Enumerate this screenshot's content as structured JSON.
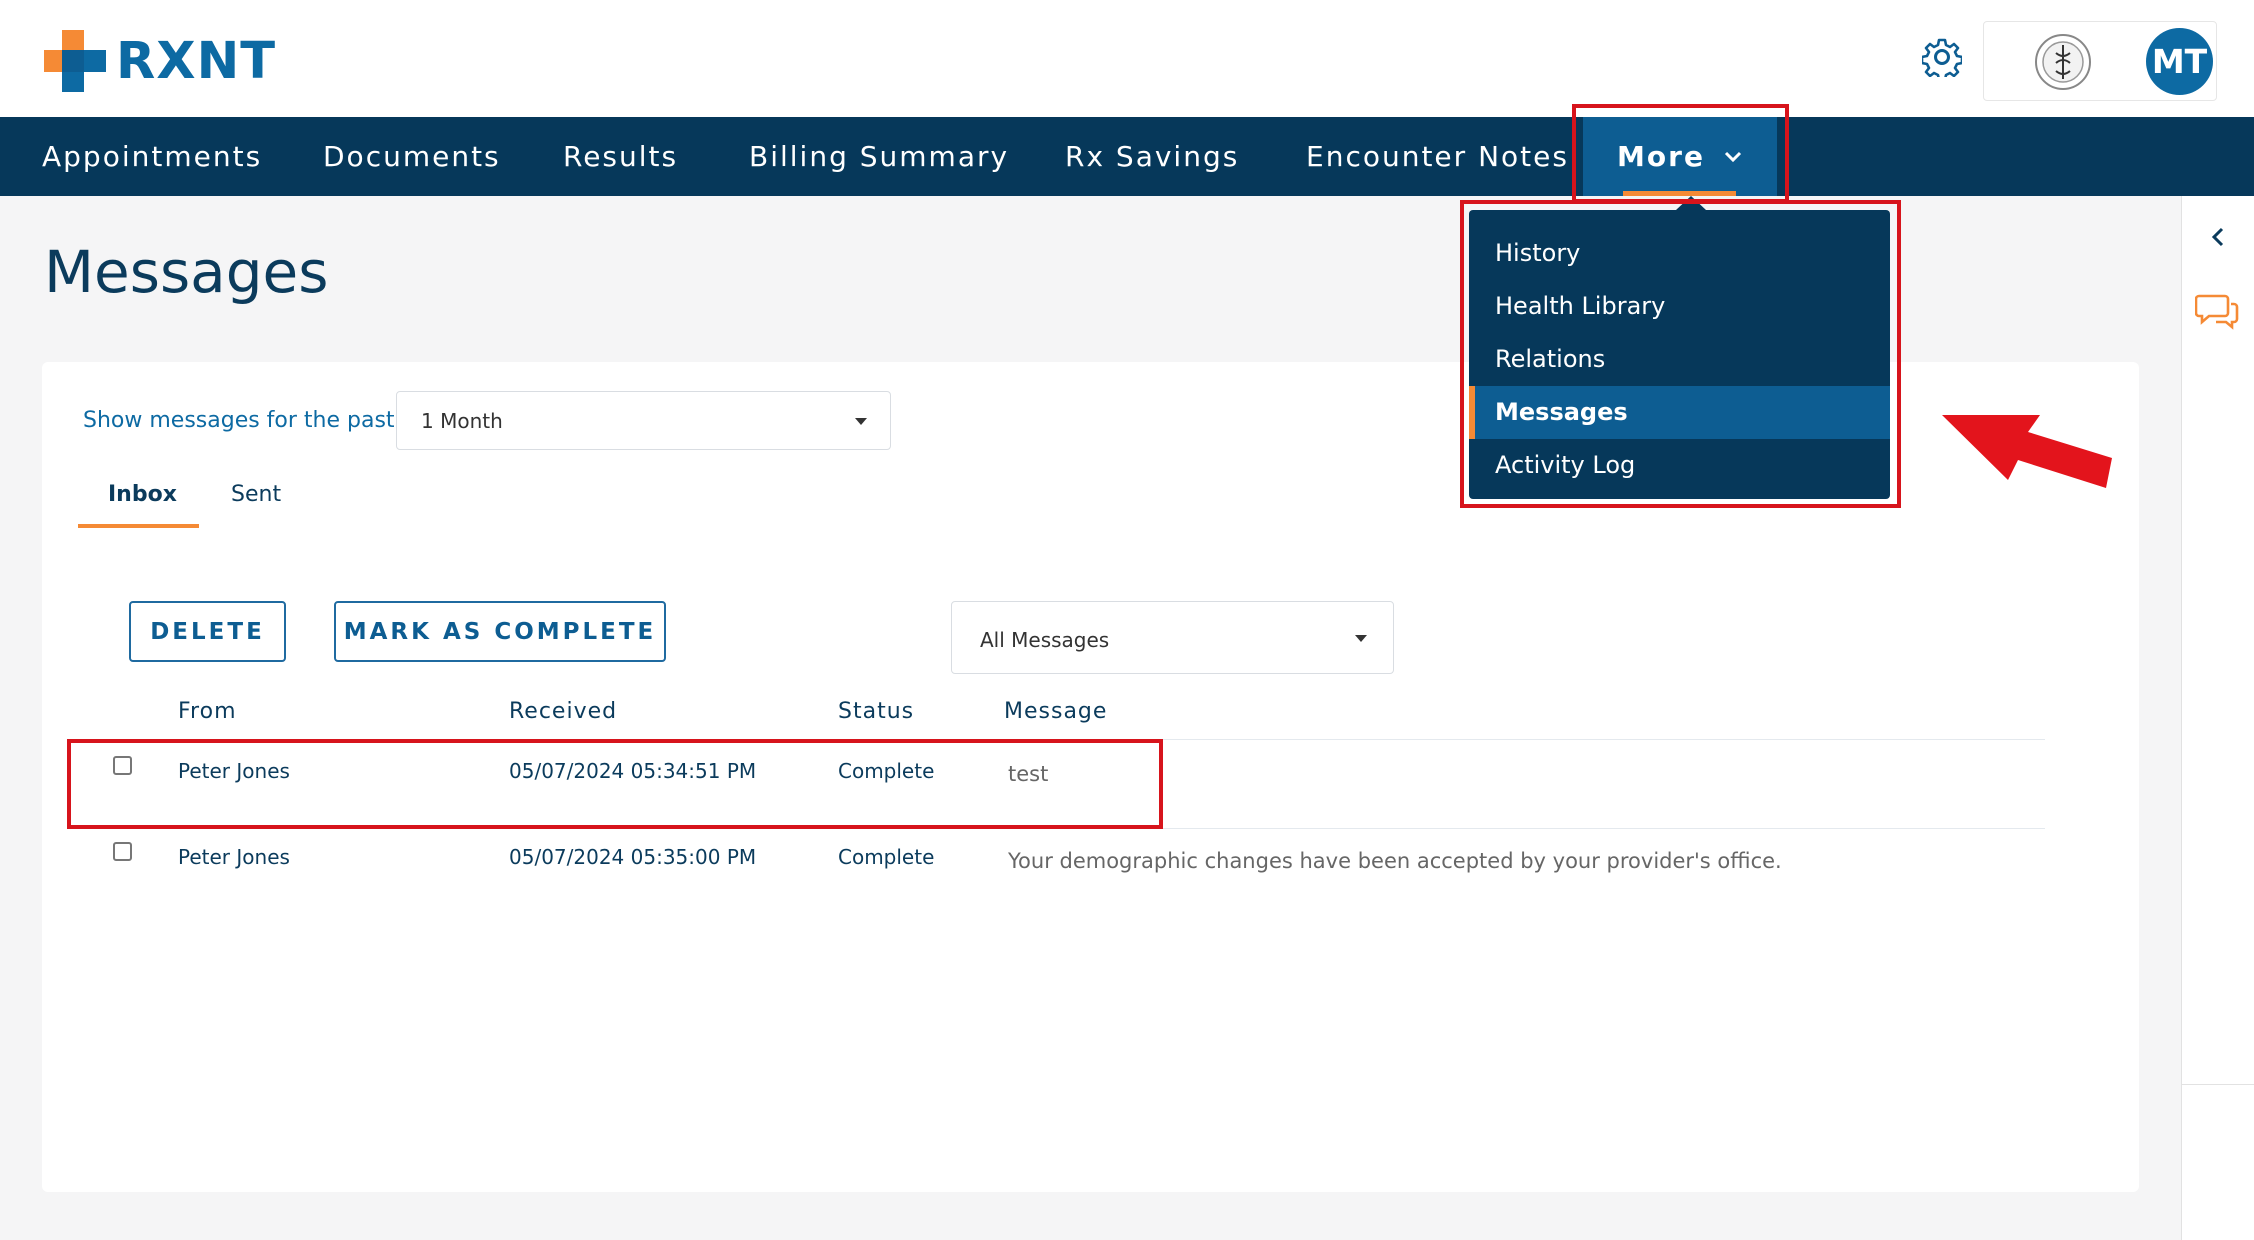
{
  "brand": {
    "name": "RXNT"
  },
  "header": {
    "user_initials": "MT"
  },
  "nav": {
    "items": [
      "Appointments",
      "Documents",
      "Results",
      "Billing Summary",
      "Rx Savings",
      "Encounter Notes"
    ],
    "more_label": "More"
  },
  "more_menu": {
    "items": [
      "History",
      "Health Library",
      "Relations",
      "Messages",
      "Activity Log"
    ],
    "active": "Messages"
  },
  "page": {
    "title": "Messages",
    "filter_label": "Show messages for the past:",
    "period_value": "1 Month",
    "tabs": [
      "Inbox",
      "Sent"
    ],
    "active_tab": "Inbox",
    "buttons": {
      "delete": "DELETE",
      "mark_complete": "MARK AS COMPLETE"
    },
    "message_filter": "All Messages"
  },
  "table": {
    "columns": [
      "From",
      "Received",
      "Status",
      "Message"
    ],
    "rows": [
      {
        "from": "Peter Jones",
        "received": "05/07/2024 05:34:51 PM",
        "status": "Complete",
        "message": "test"
      },
      {
        "from": "Peter Jones",
        "received": "05/07/2024 05:35:00 PM",
        "status": "Complete",
        "message": "Your demographic changes have been accepted by your provider's office."
      }
    ]
  },
  "colors": {
    "nav_bg": "#06385a",
    "accent": "#f58a35",
    "primary": "#0d6aa3",
    "annotation": "#d7141c"
  }
}
